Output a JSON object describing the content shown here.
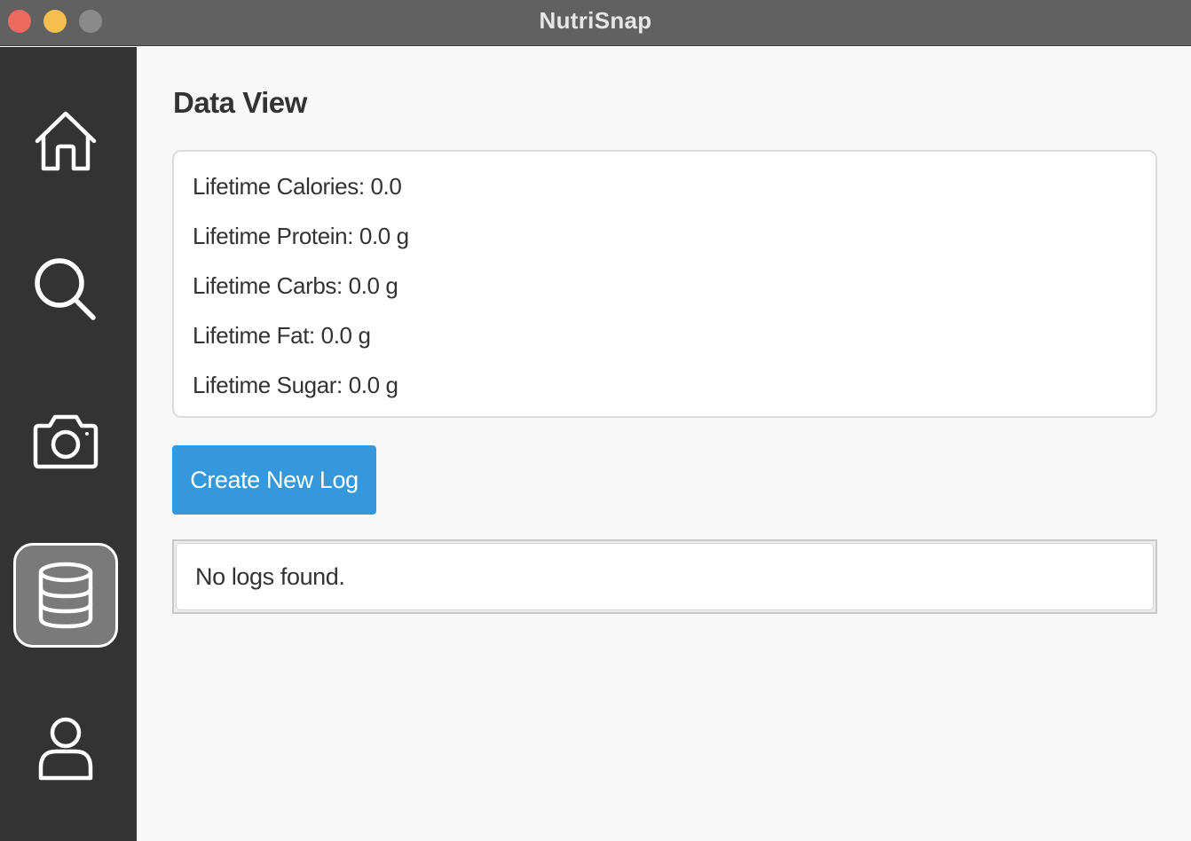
{
  "window": {
    "title": "NutriSnap"
  },
  "sidebar": {
    "items": [
      {
        "id": "home",
        "icon": "home-icon",
        "active": false
      },
      {
        "id": "search",
        "icon": "search-icon",
        "active": false
      },
      {
        "id": "camera",
        "icon": "camera-icon",
        "active": false
      },
      {
        "id": "data",
        "icon": "database-icon",
        "active": true
      },
      {
        "id": "profile",
        "icon": "user-icon",
        "active": false
      }
    ]
  },
  "main": {
    "title": "Data View",
    "stats": {
      "calories": "Lifetime Calories: 0.0",
      "protein": "Lifetime Protein: 0.0 g",
      "carbs": "Lifetime Carbs: 0.0 g",
      "fat": "Lifetime Fat: 0.0 g",
      "sugar": "Lifetime Sugar: 0.0 g"
    },
    "create_button_label": "Create New Log",
    "logs_empty_text": "No logs found."
  },
  "colors": {
    "accent": "#3498db",
    "sidebar_bg": "#333333",
    "titlebar_bg": "#616161",
    "content_bg": "#f8f8f8",
    "close": "#ec6a5e",
    "minimize": "#f4bf4f",
    "zoom": "#8a8a8a"
  }
}
